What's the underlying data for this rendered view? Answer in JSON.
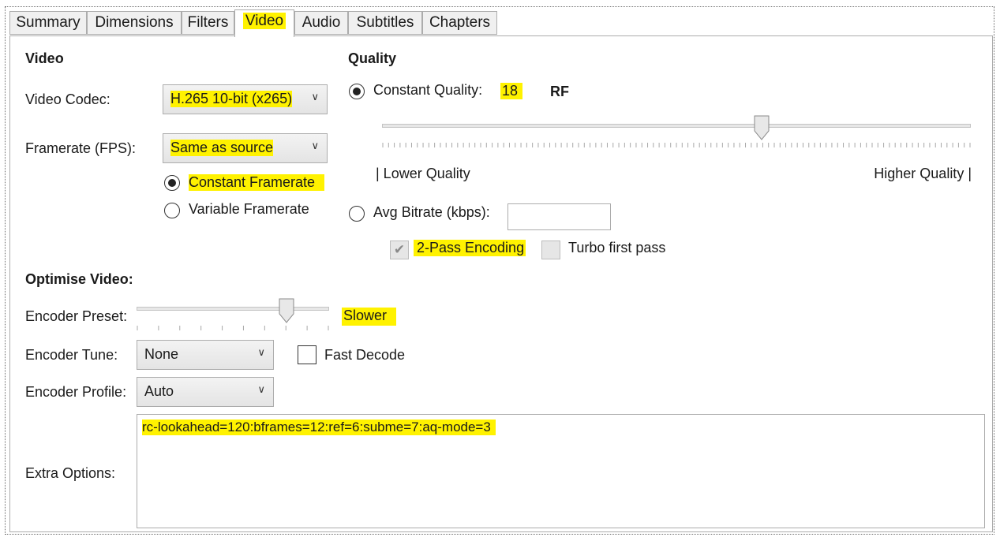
{
  "tabs": [
    {
      "label": "Summary"
    },
    {
      "label": "Dimensions"
    },
    {
      "label": "Filters"
    },
    {
      "label": "Video"
    },
    {
      "label": "Audio"
    },
    {
      "label": "Subtitles"
    },
    {
      "label": "Chapters"
    }
  ],
  "video": {
    "section_title": "Video",
    "codec_label": "Video Codec:",
    "codec_value": "H.265 10-bit (x265)",
    "framerate_label": "Framerate (FPS):",
    "framerate_value": "Same as source",
    "constant_framerate_label": "Constant Framerate",
    "variable_framerate_label": "Variable Framerate",
    "selected_framerate_mode": "constant"
  },
  "quality": {
    "section_title": "Quality",
    "constant_quality_label": "Constant Quality:",
    "constant_quality_value": "18",
    "rf_label": "RF",
    "slider_fraction": 0.645,
    "lower_label": "| Lower Quality",
    "higher_label": "Higher Quality |",
    "avg_bitrate_label": "Avg Bitrate (kbps):",
    "avg_bitrate_value": "",
    "two_pass_label": "2-Pass Encoding",
    "two_pass_checked": true,
    "turbo_label": "Turbo first pass",
    "turbo_checked": false,
    "selected_mode": "constant_quality"
  },
  "optimise": {
    "section_title": "Optimise Video:",
    "preset_label": "Encoder Preset:",
    "preset_value": "Slower",
    "preset_fraction": 0.78,
    "tune_label": "Encoder Tune:",
    "tune_value": "None",
    "fast_decode_label": "Fast Decode",
    "fast_decode_checked": false,
    "profile_label": "Encoder Profile:",
    "profile_value": "Auto",
    "extra_label": "Extra Options:",
    "extra_value": "rc-lookahead=120:bframes=12:ref=6:subme=7:aq-mode=3"
  },
  "colors": {
    "highlight": "#fff200",
    "border": "#acacac"
  }
}
